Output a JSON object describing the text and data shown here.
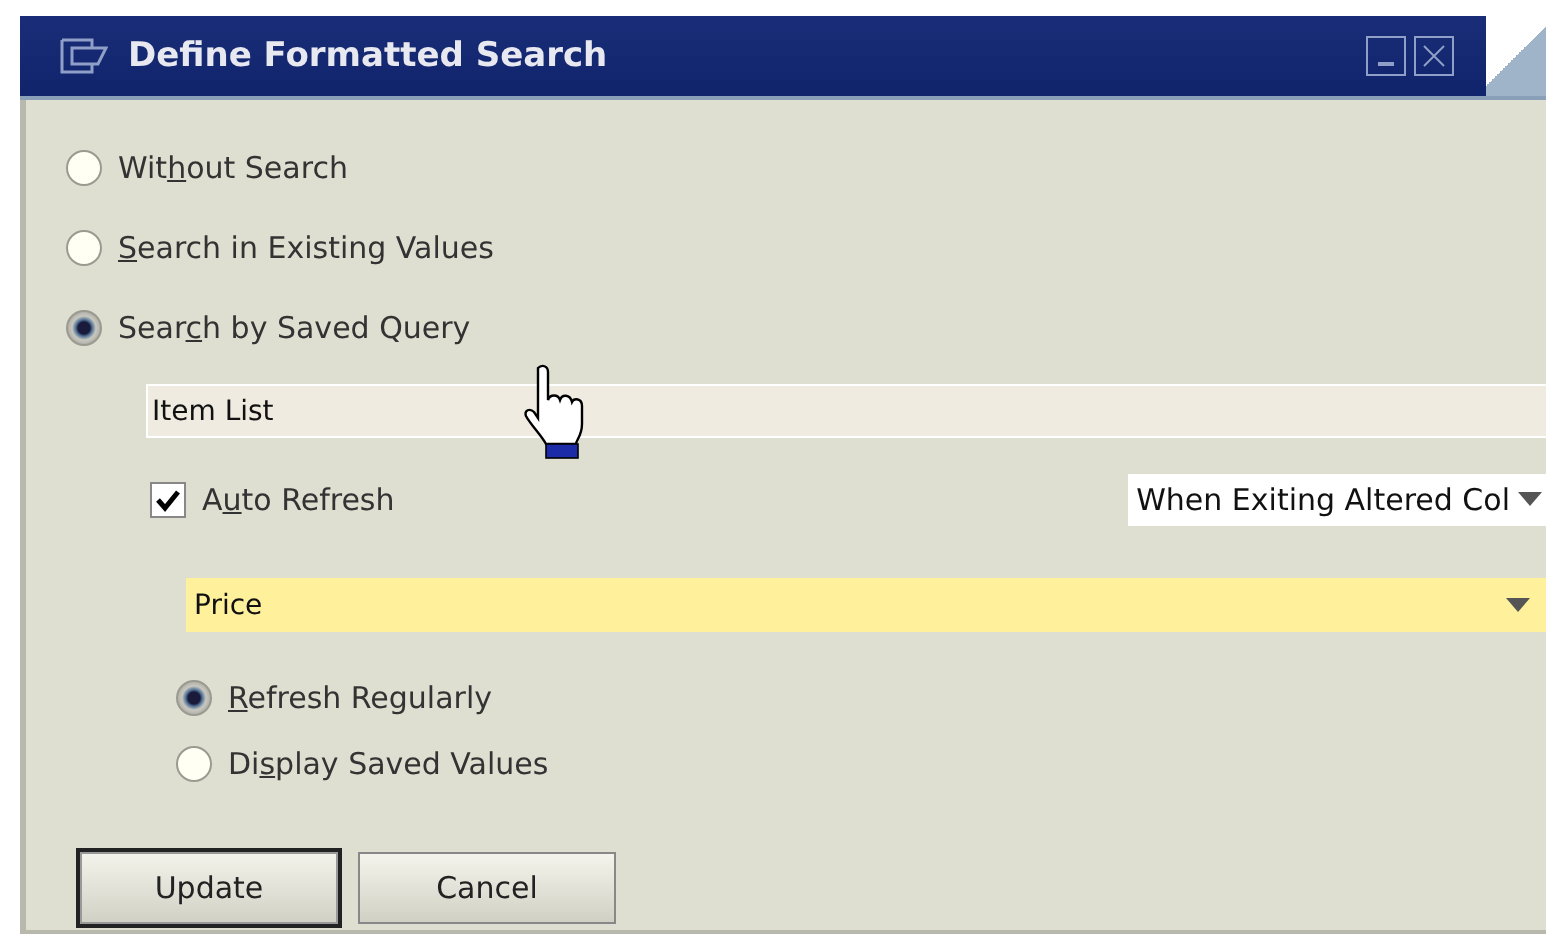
{
  "window": {
    "title": "Define Formatted Search"
  },
  "search_modes": [
    {
      "before": "Wit",
      "key": "h",
      "after": "out Search",
      "selected": false
    },
    {
      "key": "S",
      "after": "earch in Existing Values",
      "selected": false
    },
    {
      "before": "Sear",
      "key": "c",
      "after": "h by Saved Query",
      "selected": true
    }
  ],
  "query_field": {
    "value": "Item List"
  },
  "auto_refresh": {
    "before": "A",
    "key": "u",
    "after": "to Refresh",
    "checked": true
  },
  "refresh_trigger": {
    "value": "When Exiting Altered Col"
  },
  "field_select": {
    "value": "Price"
  },
  "refresh_modes": [
    {
      "key": "R",
      "after": "efresh Regularly",
      "selected": true
    },
    {
      "before": "Di",
      "key": "s",
      "after": "play Saved Values",
      "selected": false
    }
  ],
  "buttons": [
    {
      "label": "Update",
      "default": true
    },
    {
      "label": "Cancel",
      "default": false
    }
  ]
}
